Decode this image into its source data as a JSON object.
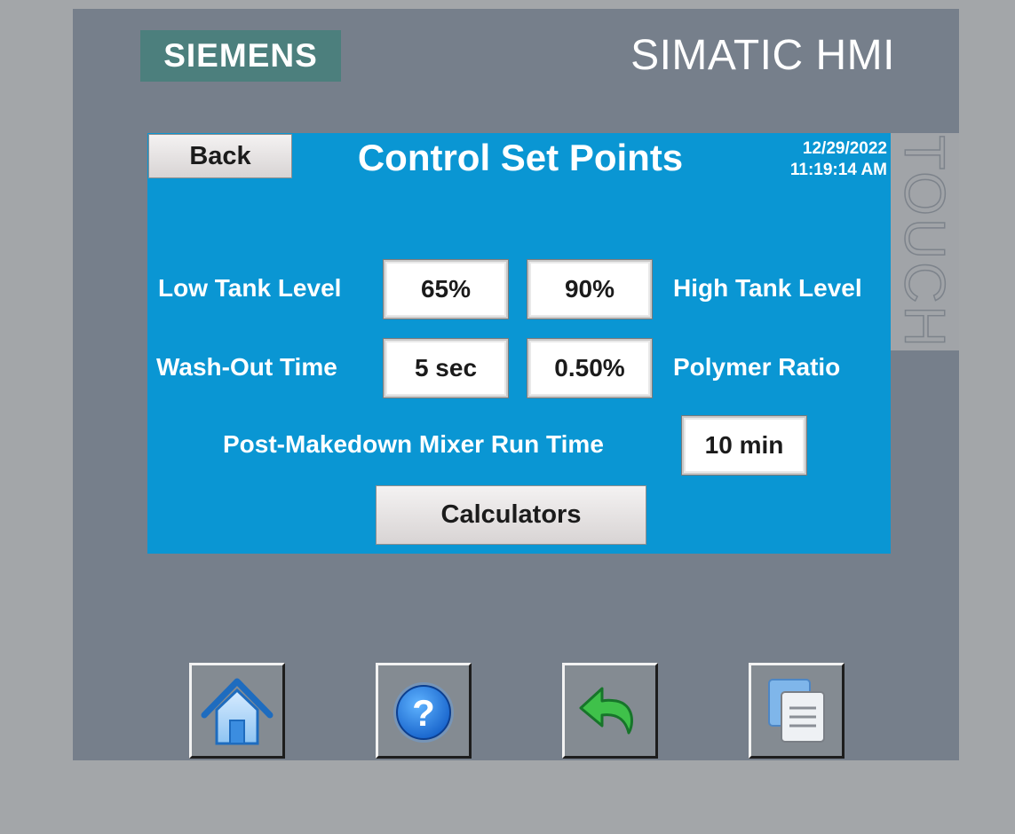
{
  "device": {
    "brand": "SIEMENS",
    "product": "SIMATIC HMI",
    "vertical_label": "TOUCH"
  },
  "screen": {
    "title": "Control Set Points",
    "back_label": "Back",
    "date": "12/29/2022",
    "time": "11:19:14 AM",
    "background_color": "#0a96d3"
  },
  "setpoints": {
    "low_tank_level": {
      "label": "Low Tank Level",
      "value": "65%"
    },
    "high_tank_level": {
      "label": "High Tank Level",
      "value": "90%"
    },
    "wash_out_time": {
      "label": "Wash-Out Time",
      "value": "5 sec"
    },
    "polymer_ratio": {
      "label": "Polymer Ratio",
      "value": "0.50%"
    },
    "mixer_run_time": {
      "label": "Post-Makedown Mixer Run Time",
      "value": "10 min"
    }
  },
  "calculators_label": "Calculators",
  "nav_buttons": [
    {
      "icon": "home-icon"
    },
    {
      "icon": "help-icon"
    },
    {
      "icon": "return-arrow-icon"
    },
    {
      "icon": "screens-icon"
    }
  ]
}
